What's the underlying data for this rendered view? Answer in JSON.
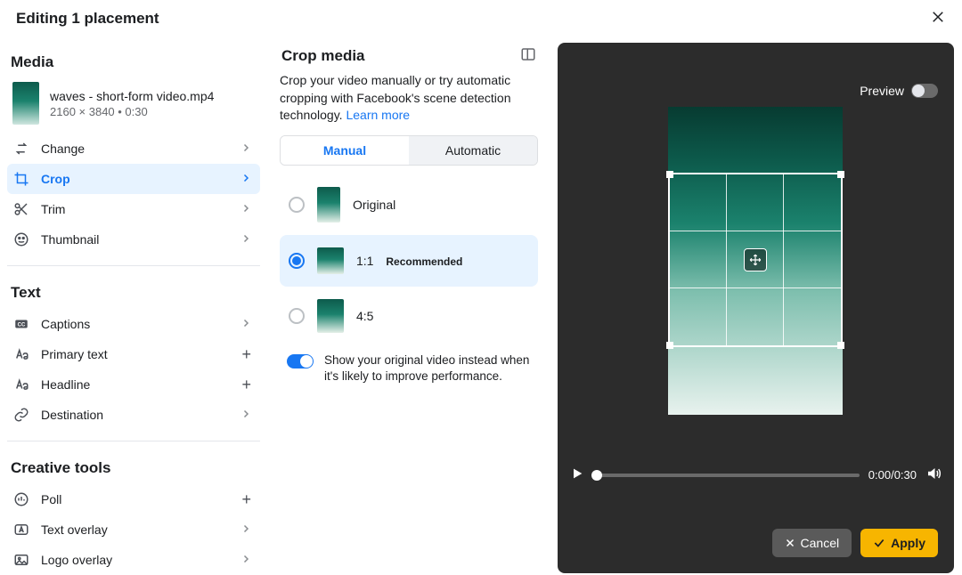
{
  "header": {
    "title": "Editing 1 placement"
  },
  "sidebar": {
    "media_section": "Media",
    "media_file": "waves - short-form video.mp4",
    "media_meta": "2160 × 3840 • 0:30",
    "rows": [
      {
        "label": "Change"
      },
      {
        "label": "Crop"
      },
      {
        "label": "Trim"
      },
      {
        "label": "Thumbnail"
      }
    ],
    "text_section": "Text",
    "text_rows": [
      {
        "label": "Captions"
      },
      {
        "label": "Primary text"
      },
      {
        "label": "Headline"
      },
      {
        "label": "Destination"
      }
    ],
    "tools_section": "Creative tools",
    "tool_rows": [
      {
        "label": "Poll"
      },
      {
        "label": "Text overlay"
      },
      {
        "label": "Logo overlay"
      }
    ]
  },
  "crop": {
    "title": "Crop media",
    "desc": "Crop your video manually or try automatic cropping with Facebook's scene detection technology. ",
    "learn": "Learn more",
    "seg": {
      "manual": "Manual",
      "auto": "Automatic"
    },
    "options": [
      {
        "label": "Original"
      },
      {
        "label": "1:1",
        "rec": "Recommended"
      },
      {
        "label": "4:5"
      }
    ],
    "improve": "Show your original video instead when it's likely to improve performance."
  },
  "preview": {
    "label": "Preview",
    "time": "0:00/0:30",
    "cancel": "Cancel",
    "apply": "Apply"
  }
}
